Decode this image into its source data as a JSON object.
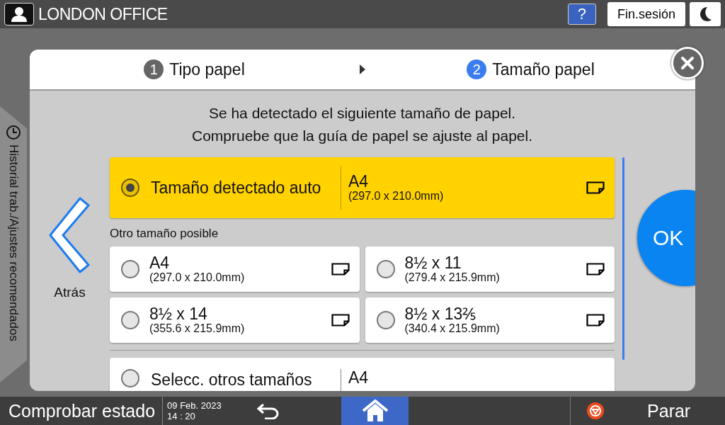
{
  "header": {
    "user": "LONDON OFFICE",
    "help": "?",
    "logout": "Fin.sesión"
  },
  "side_tab": {
    "label": "Historial trab./Ajustes recomendados"
  },
  "dialog": {
    "steps": [
      {
        "number": "1",
        "label": "Tipo papel",
        "selected": false
      },
      {
        "number": "2",
        "label": "Tamaño papel",
        "selected": true
      }
    ],
    "message": [
      "Se ha detectado el siguiente tamaño de papel.",
      "Compruebe que la guía de papel se ajuste al papel."
    ],
    "back": "Atrás",
    "auto": {
      "label": "Tamaño detectado auto",
      "size": "A4",
      "dims": "(297.0 x 210.0mm)",
      "selected": true
    },
    "other_label": "Otro tamaño posible",
    "options": [
      {
        "size": "A4",
        "dims": "(297.0 x 210.0mm)",
        "selected": false
      },
      {
        "size": "8½ x 11",
        "dims": "(279.4 x 215.9mm)",
        "selected": false
      },
      {
        "size": "8½ x 14",
        "dims": "(355.6 x 215.9mm)",
        "selected": false
      },
      {
        "size": "8½ x 13⅖",
        "dims": "(340.4 x 215.9mm)",
        "selected": false
      }
    ],
    "more": {
      "label": "Selecc. otros tamaños",
      "size": "A4",
      "selected": false
    },
    "ok": "OK"
  },
  "footer": {
    "status": "Comprobar estado",
    "date": "09 Feb. 2023",
    "time": "14 : 20",
    "stop": "Parar"
  }
}
